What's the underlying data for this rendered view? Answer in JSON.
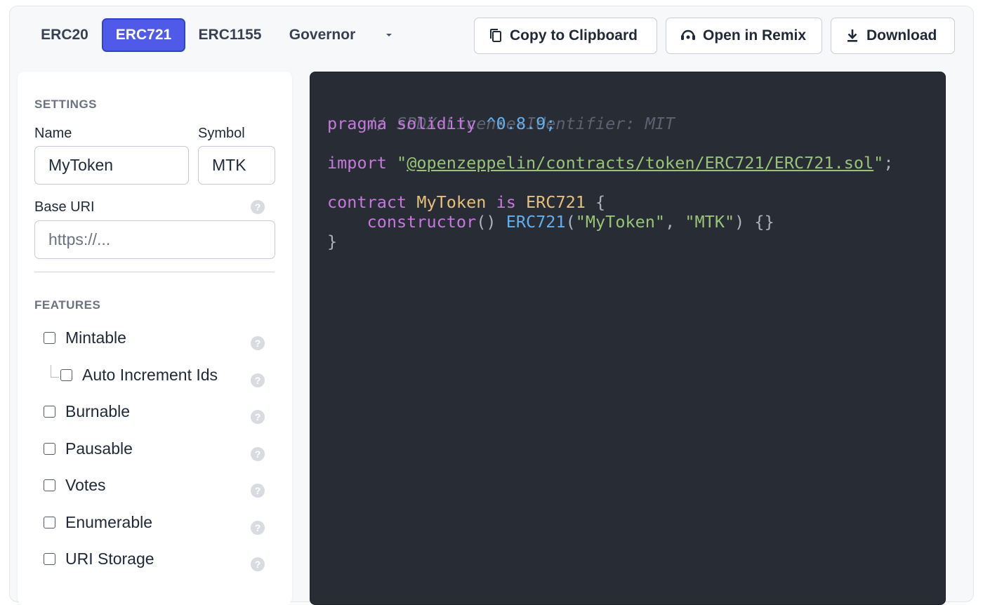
{
  "tabs": [
    {
      "label": "ERC20",
      "active": false
    },
    {
      "label": "ERC721",
      "active": true
    },
    {
      "label": "ERC1155",
      "active": false
    },
    {
      "label": "Governor",
      "active": false
    }
  ],
  "actions": {
    "copy_label": "Copy to Clipboard",
    "remix_label": "Open in Remix",
    "download_label": "Download"
  },
  "settings": {
    "title": "SETTINGS",
    "name_label": "Name",
    "name_value": "MyToken",
    "symbol_label": "Symbol",
    "symbol_value": "MTK",
    "base_uri_label": "Base URI",
    "base_uri_placeholder": "https://...",
    "help_glyph": "?"
  },
  "features": {
    "title": "FEATURES",
    "items": [
      {
        "label": "Mintable",
        "checked": false
      },
      {
        "label": "Auto Increment Ids",
        "checked": false,
        "nested": true
      },
      {
        "label": "Burnable",
        "checked": false
      },
      {
        "label": "Pausable",
        "checked": false
      },
      {
        "label": "Votes",
        "checked": false
      },
      {
        "label": "Enumerable",
        "checked": false
      },
      {
        "label": "URI Storage",
        "checked": false
      }
    ]
  },
  "code": {
    "comment": "// SPDX-License-Identifier: MIT",
    "pragma_kw": "pragma solidity",
    "pragma_ver": "^0.8.9;",
    "import_kw": "import",
    "import_path": "@openzeppelin/contracts/token/ERC721/ERC721.sol",
    "contract_kw": "contract",
    "contract_name": "MyToken",
    "is_kw": "is",
    "base": "ERC721",
    "ctor_kw": "constructor",
    "ctor_base": "ERC721",
    "arg1": "\"MyToken\"",
    "arg2": "\"MTK\""
  },
  "colors": {
    "accent": "#4f5ae8",
    "code_bg": "#282c34"
  }
}
